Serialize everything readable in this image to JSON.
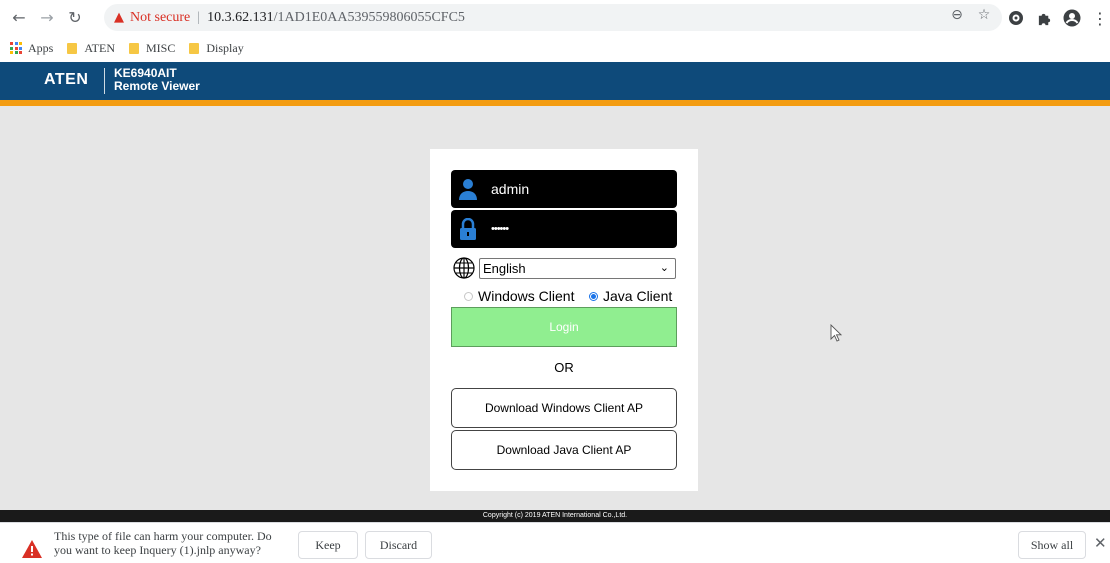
{
  "browser": {
    "security_label": "Not secure",
    "url_host": "10.3.62.131",
    "url_path": "/1AD1E0AA539559806055CFC5",
    "icons": [
      "back-icon",
      "forward-icon",
      "reload-icon",
      "zoom-icon",
      "star-icon",
      "extension-icon",
      "puzzle-icon",
      "profile-icon",
      "menu-icon"
    ]
  },
  "bookmarks": [
    {
      "label": "Apps",
      "icon": "apps-grid-icon"
    },
    {
      "label": "ATEN",
      "icon": "folder-icon"
    },
    {
      "label": "MISC",
      "icon": "folder-icon"
    },
    {
      "label": "Display",
      "icon": "folder-icon"
    }
  ],
  "app": {
    "brand": "ATEN",
    "product_line1": "KE6940AIT",
    "product_line2": "Remote Viewer",
    "colors": {
      "header": "#0e4a7a",
      "stripe": "#f39c12",
      "login_button": "#90ee90"
    }
  },
  "login": {
    "username": "admin",
    "password_mask": "••••••",
    "language": "English",
    "radio_windows": "Windows Client",
    "radio_java": "Java Client",
    "selected_client": "Java Client",
    "login_label": "Login",
    "or_label": "OR",
    "download_windows": "Download Windows Client AP",
    "download_java": "Download Java Client AP"
  },
  "footer": {
    "copyright": "Copyright (c) 2019 ATEN International Co.,Ltd."
  },
  "download_bar": {
    "message_line1": "This type of file can harm your computer. Do",
    "message_line2": "you want to keep Inquery (1).jnlp anyway?",
    "keep_label": "Keep",
    "discard_label": "Discard",
    "show_all_label": "Show all"
  }
}
